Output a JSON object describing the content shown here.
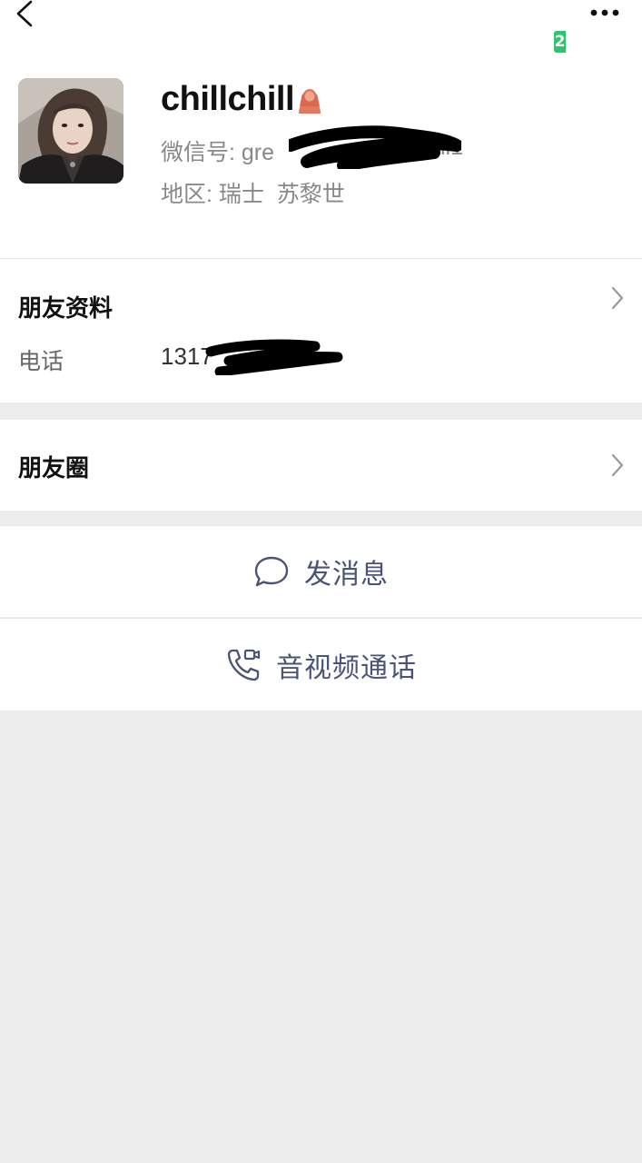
{
  "header": {
    "back_icon": "chevron-left-icon",
    "more_icon": "ellipsis-icon",
    "badge_text": "2"
  },
  "profile": {
    "avatar_icon": "avatar-photo",
    "nickname": "chillchill",
    "gender_icon": "female-icon",
    "gender_color": "#e07a5f",
    "wxid_label": "微信号:",
    "wxid_value_prefix": "gre",
    "wxid_value_suffix": "il1",
    "region_label": "地区:",
    "region_value": "瑞士  苏黎世"
  },
  "friend_info": {
    "title": "朋友资料",
    "phone_label": "电话",
    "phone_value_prefix": "1317"
  },
  "moments": {
    "title": "朋友圈"
  },
  "actions": {
    "message_icon": "chat-bubble-icon",
    "message_label": "发消息",
    "call_icon": "phone-video-icon",
    "call_label": "音视频通话",
    "label_color": "#4a5378"
  }
}
